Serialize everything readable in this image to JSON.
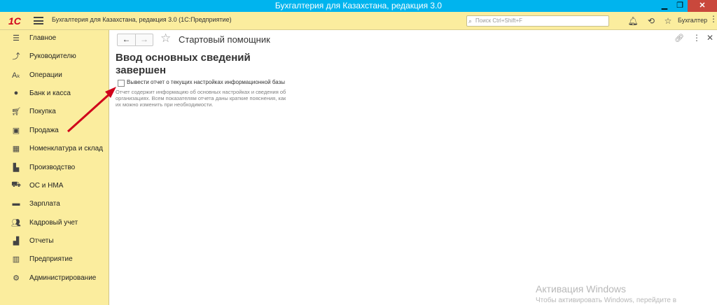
{
  "window": {
    "title": "Бухгалтерия для Казахстана, редакция 3.0",
    "controls": [
      "minimize-icon",
      "restore-icon",
      "close-icon"
    ]
  },
  "appbar": {
    "logo": "1С",
    "title": "Бухгалтерия для Казахстана, редакция 3.0  (1С:Предприятие)",
    "search_placeholder": "Поиск Ctrl+Shift+F",
    "user": "Бухгалтер"
  },
  "sidebar": {
    "items": [
      {
        "label": "Главное",
        "icon": "menu-icon"
      },
      {
        "label": "Руководителю",
        "icon": "trend-icon"
      },
      {
        "label": "Операции",
        "icon": "operations-icon"
      },
      {
        "label": "Банк и касса",
        "icon": "coins-icon"
      },
      {
        "label": "Покупка",
        "icon": "cart-icon"
      },
      {
        "label": "Продажа",
        "icon": "bag-icon"
      },
      {
        "label": "Номенклатура и склад",
        "icon": "grid-icon"
      },
      {
        "label": "Производство",
        "icon": "factory-icon"
      },
      {
        "label": "ОС и НМА",
        "icon": "truck-icon"
      },
      {
        "label": "Зарплата",
        "icon": "wallet-icon"
      },
      {
        "label": "Кадровый учет",
        "icon": "people-icon"
      },
      {
        "label": "Отчеты",
        "icon": "bar-chart-icon"
      },
      {
        "label": "Предприятие",
        "icon": "building-icon"
      },
      {
        "label": "Администрирование",
        "icon": "gear-icon"
      }
    ]
  },
  "form": {
    "title": "Стартовый помощник",
    "heading": "Ввод основных сведений завершен",
    "checkbox_label": "Вывести отчет о текущих настройках информационной базы",
    "checkbox_checked": false,
    "description": "Отчет содержит информацию об основных настройках и сведения об организациях. Всем показателям отчета даны краткие пояснения, как их можно изменить при необходимости."
  },
  "watermark": {
    "title": "Активация Windows",
    "subtitle": "Чтобы активировать Windows, перейдите в"
  },
  "colors": {
    "titlebar": "#00b4ee",
    "panel": "#fbed9e",
    "arrow": "#d0021b"
  }
}
